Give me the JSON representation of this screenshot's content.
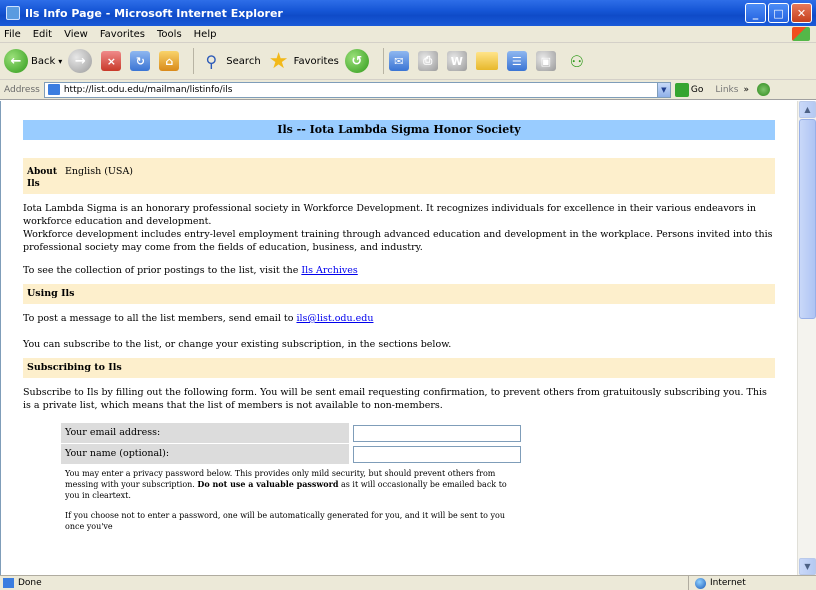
{
  "window": {
    "title": "Ils Info Page - Microsoft Internet Explorer",
    "buttons": {
      "minimize": "_",
      "maximize": "□",
      "close": "✕"
    }
  },
  "menu": [
    "File",
    "Edit",
    "View",
    "Favorites",
    "Tools",
    "Help"
  ],
  "toolbar": {
    "back": "Back",
    "search": "Search",
    "favorites": "Favorites"
  },
  "address": {
    "label": "Address",
    "url": "http://list.odu.edu/mailman/listinfo/ils",
    "go": "Go",
    "links": "Links"
  },
  "page": {
    "title": "Ils -- Iota Lambda Sigma Honor Society",
    "about_label": "About Ils",
    "about_value": "English (USA)",
    "intro_1": "Iota Lambda Sigma is an honorary professional society in Workforce Development. It recognizes individuals for excellence in their various endeavors in workforce education and development.",
    "intro_2": "Workforce development includes entry-level employment training through advanced education and development in the workplace. Persons invited into this professional society may come from the fields of education, business, and industry.",
    "archives_text": "To see the collection of prior postings to the list, visit the",
    "archives_link": "Ils Archives",
    "using_heading": "Using Ils",
    "post_text": "To post a message to all the list members, send email to",
    "post_email": "ils@list.odu.edu",
    "subscribe_text": "You can subscribe to the list, or change your existing subscription, in the sections below.",
    "subscribing_heading": "Subscribing to Ils",
    "subscribing_para": "Subscribe to Ils by filling out the following form. You will be sent email requesting confirmation, to prevent others from gratuitously subscribing you. This is a private list, which means that the list of members is not available to non-members.",
    "form": {
      "email_label": "Your email address:",
      "name_label": "Your name (optional):",
      "note_1": "You may enter a privacy password below. This provides only mild security, but should prevent others from messing with your subscription.",
      "note_bold": "Do not use a valuable password",
      "note_2": "as it will occasionally be emailed back to you in cleartext.",
      "note_3": "If you choose not to enter a password, one will be automatically generated for you, and it will be sent to you once you've"
    }
  },
  "status": {
    "text": "Done",
    "zone": "Internet"
  }
}
